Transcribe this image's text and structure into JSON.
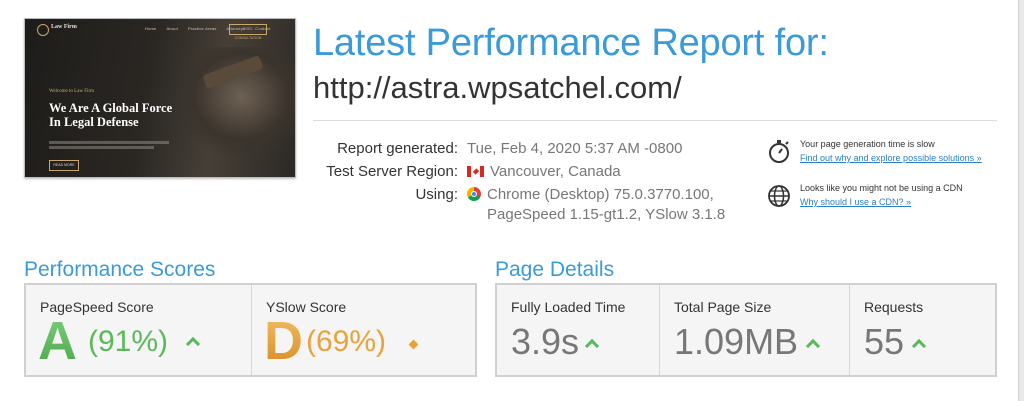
{
  "thumbnail": {
    "logo_text": "Law Firm",
    "menu": [
      "Home",
      "About",
      "Practice Areas",
      "Attorneys",
      "Contact"
    ],
    "cta": "FREE CONSULTATION",
    "welcome": "Welcome to Law Firm",
    "headline_line1": "We Are A Global Force",
    "headline_line2": "In Legal Defense",
    "button": "READ MORE"
  },
  "header": {
    "title": "Latest Performance Report for:",
    "url": "http://astra.wpsatchel.com/"
  },
  "report": {
    "generated_label": "Report generated:",
    "generated_value": "Tue, Feb 4, 2020 5:37 AM -0800",
    "region_label": "Test Server Region:",
    "region_value": "Vancouver, Canada",
    "using_label": "Using:",
    "using_value_line1": "Chrome (Desktop) 75.0.3770.100,",
    "using_value_line2": "PageSpeed 1.15-gt1.2, YSlow 3.1.8"
  },
  "tips": [
    {
      "icon": "stopwatch-icon",
      "text": "Your page generation time is slow",
      "link": "Find out why and explore possible solutions »"
    },
    {
      "icon": "globe-icon",
      "text": "Looks like you might not be using a CDN",
      "link": "Why should I use a CDN? »"
    }
  ],
  "performance": {
    "title": "Performance Scores",
    "pagespeed": {
      "label": "PageSpeed Score",
      "grade": "A",
      "pct": "(91%)",
      "color": "#5cb85c",
      "trend": "up"
    },
    "yslow": {
      "label": "YSlow Score",
      "grade": "D",
      "pct": "(69%)",
      "color": "#e8a33b",
      "trend": "neutral"
    }
  },
  "details": {
    "title": "Page Details",
    "loaded": {
      "label": "Fully Loaded Time",
      "value": "3.9s",
      "trend": "up"
    },
    "size": {
      "label": "Total Page Size",
      "value": "1.09MB",
      "trend": "up"
    },
    "requests": {
      "label": "Requests",
      "value": "55",
      "trend": "up"
    }
  },
  "colors": {
    "accent": "#3b9ad8",
    "good": "#5cb85c",
    "warn": "#e8a33b"
  }
}
